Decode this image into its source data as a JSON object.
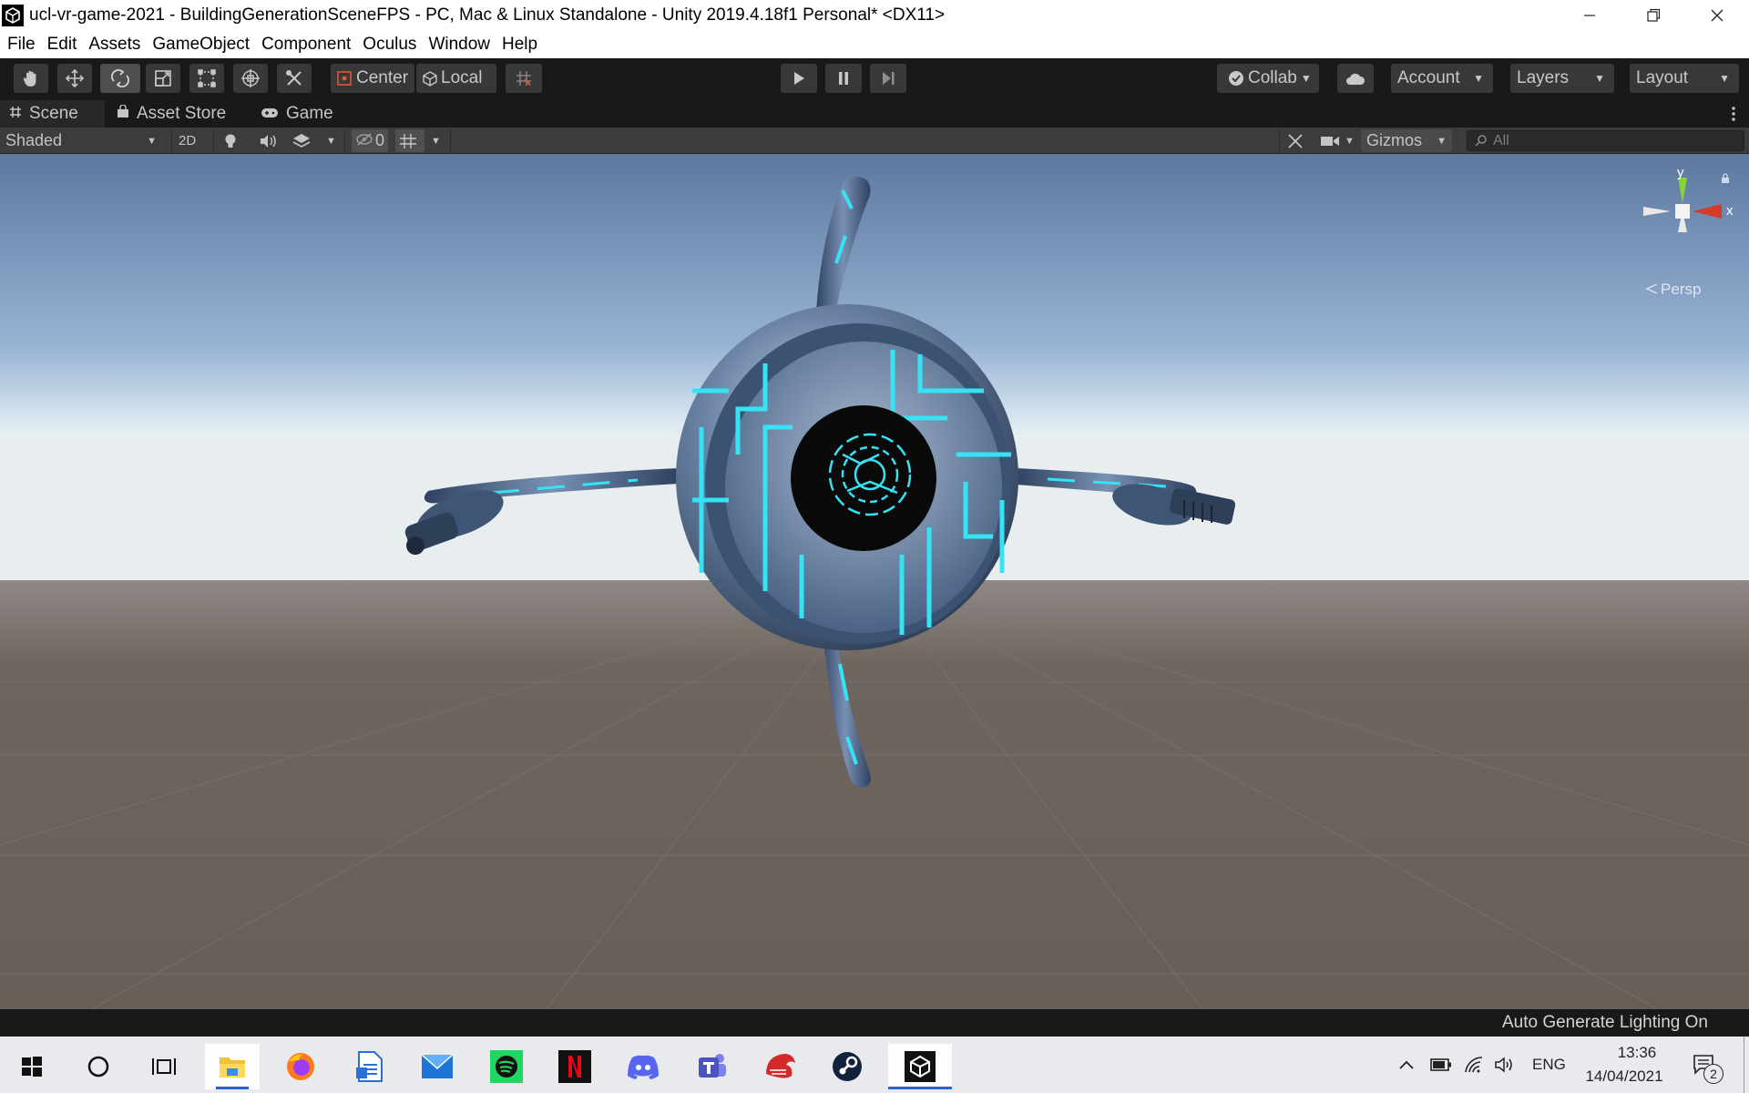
{
  "window": {
    "title": "ucl-vr-game-2021 - BuildingGenerationSceneFPS - PC, Mac & Linux Standalone - Unity 2019.4.18f1 Personal* <DX11>",
    "minimize_icon": "minimize-icon",
    "restore_icon": "restore-icon",
    "close_icon": "close-icon"
  },
  "menu": {
    "items": [
      "File",
      "Edit",
      "Assets",
      "GameObject",
      "Component",
      "Oculus",
      "Window",
      "Help"
    ]
  },
  "toolbar": {
    "tools": [
      "hand-tool",
      "move-tool",
      "rotate-tool",
      "scale-tool",
      "rect-tool",
      "transform-tool",
      "custom-tool"
    ],
    "active_tool": "rotate-tool",
    "pivot_label": "Center",
    "space_label": "Local",
    "collab_label": "Collab",
    "account_label": "Account",
    "layers_label": "Layers",
    "layout_label": "Layout"
  },
  "tabs": {
    "scene": "Scene",
    "asset_store": "Asset Store",
    "game": "Game",
    "active": "Scene"
  },
  "scene_toolbar": {
    "draw_mode": "Shaded",
    "mode_2d": "2D",
    "hidden_count": "0",
    "gizmos_label": "Gizmos",
    "search_placeholder": "All"
  },
  "gizmo": {
    "y_label": "y",
    "x_label": "x",
    "projection": "Persp"
  },
  "status": {
    "text": "Auto Generate Lighting On"
  },
  "taskbar": {
    "apps": [
      "start-icon",
      "search-icon",
      "task-view-icon",
      "file-explorer-icon",
      "firefox-icon",
      "word-document-icon",
      "mail-icon",
      "spotify-icon",
      "netflix-icon",
      "discord-icon",
      "teams-icon",
      "razer-icon",
      "steam-icon",
      "unity-icon"
    ],
    "active_app": "unity-icon",
    "language": "ENG",
    "time": "13:36",
    "date": "14/04/2021",
    "notification_count": "2"
  },
  "colors": {
    "sky_top": "#5d78a0",
    "horizon": "#dbe9f1",
    "ground": "#6e6560",
    "accent_cyan": "#36e3f5",
    "drone_metal": "#4a6384"
  }
}
